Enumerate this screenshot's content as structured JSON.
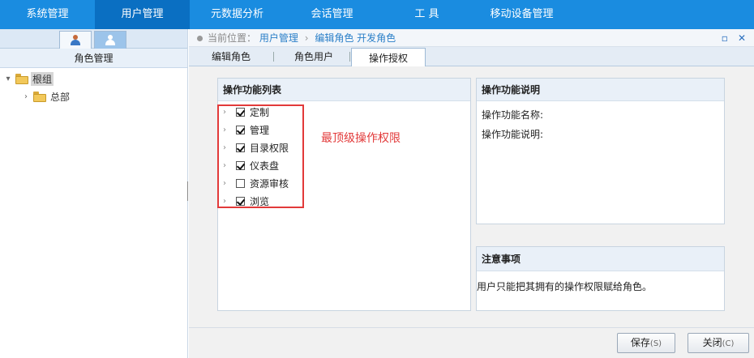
{
  "topnav": {
    "items": [
      {
        "label": "系统管理"
      },
      {
        "label": "用户管理"
      },
      {
        "label": "元数据分析"
      },
      {
        "label": "会话管理"
      },
      {
        "label": "工 具"
      },
      {
        "label": "移动设备管理"
      }
    ],
    "active_index": 1
  },
  "left_panel": {
    "title": "角色管理",
    "tree": [
      {
        "label": "根组",
        "expanded": true
      },
      {
        "label": "总部",
        "expanded": false
      }
    ]
  },
  "breadcrumb": {
    "prefix": "当前位置：",
    "items": [
      "用户管理",
      "编辑角色",
      "开发角色"
    ]
  },
  "tabs": [
    {
      "label": "编辑角色"
    },
    {
      "label": "角色用户"
    },
    {
      "label": "操作授权"
    }
  ],
  "active_tab": 2,
  "perm_list": {
    "title": "操作功能列表",
    "items": [
      {
        "label": "定制",
        "checked": true
      },
      {
        "label": "管理",
        "checked": true
      },
      {
        "label": "目录权限",
        "checked": true
      },
      {
        "label": "仪表盘",
        "checked": true
      },
      {
        "label": "资源审核",
        "checked": false
      },
      {
        "label": "浏览",
        "checked": true
      }
    ]
  },
  "annotation": "最顶级操作权限",
  "perm_desc": {
    "title": "操作功能说明",
    "name_label": "操作功能名称:",
    "desc_label": "操作功能说明:"
  },
  "notes": {
    "title": "注意事项",
    "text": "用户只能把其拥有的操作权限赋给角色。"
  },
  "footer": {
    "save_label": "保存",
    "save_key": "(S)",
    "close_label": "关闭",
    "close_key": "(C)"
  },
  "colors": {
    "nav_bg": "#1a8ce0",
    "nav_active": "#0a6fc2",
    "annotation": "#e23a3a"
  }
}
